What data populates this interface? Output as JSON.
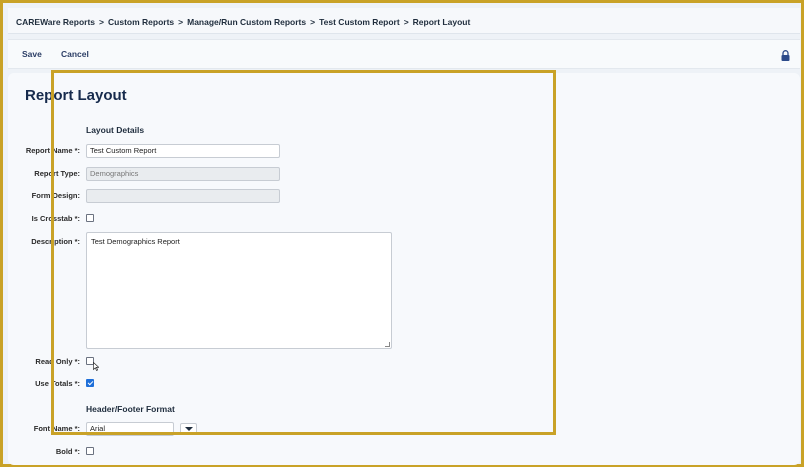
{
  "breadcrumb": {
    "items": [
      "CAREWare Reports",
      "Custom Reports",
      "Manage/Run Custom Reports",
      "Test Custom Report",
      "Report Layout"
    ],
    "separator": ">"
  },
  "toolbar": {
    "save_label": "Save",
    "cancel_label": "Cancel"
  },
  "page": {
    "title": "Report Layout"
  },
  "layout_details": {
    "heading": "Layout Details",
    "report_name_label": "Report Name *:",
    "report_name_value": "Test Custom Report",
    "report_type_label": "Report Type:",
    "report_type_value": "Demographics",
    "form_design_label": "Form Design:",
    "form_design_value": "",
    "is_crosstab_label": "Is Crosstab *:",
    "is_crosstab_checked": false,
    "description_label": "Description *:",
    "description_value": "Test Demographics Report",
    "read_only_label": "Read Only *:",
    "read_only_checked": false,
    "use_totals_label": "Use Totals *:",
    "use_totals_checked": true
  },
  "header_footer": {
    "heading": "Header/Footer Format",
    "font_name_label": "Font Name *:",
    "font_name_value": "Arial",
    "bold_label": "Bold *:",
    "bold_checked": false
  },
  "colors": {
    "accent": "#1e6fd9",
    "highlight": "#c9a227"
  }
}
